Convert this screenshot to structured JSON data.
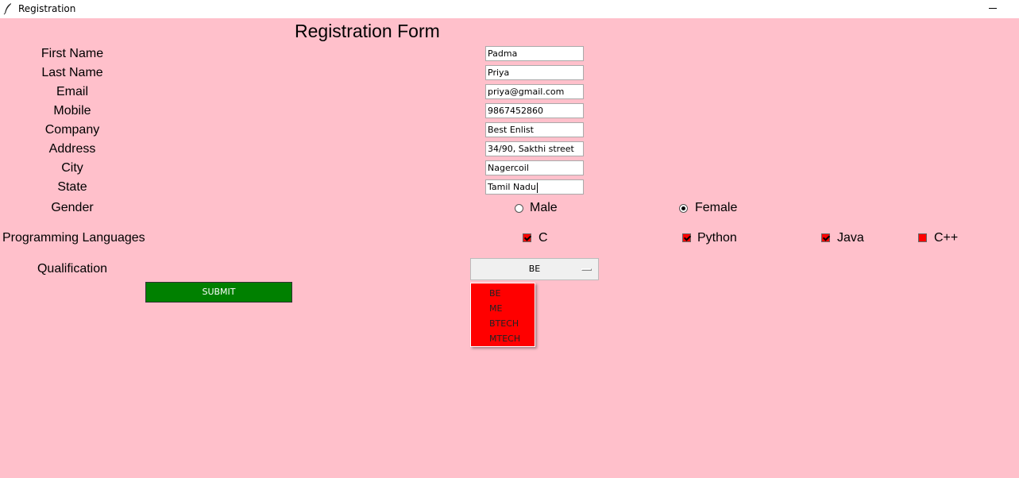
{
  "window": {
    "title": "Registration",
    "icon": "feather-icon"
  },
  "form": {
    "heading": "Registration Form",
    "fields": [
      {
        "label": "First Name",
        "value": "Padma"
      },
      {
        "label": "Last Name",
        "value": "Priya"
      },
      {
        "label": "Email",
        "value": "priya@gmail.com"
      },
      {
        "label": "Mobile",
        "value": "9867452860"
      },
      {
        "label": "Company",
        "value": "Best Enlist"
      },
      {
        "label": "Address",
        "value": "34/90, Sakthi street"
      },
      {
        "label": "City",
        "value": "Nagercoil"
      },
      {
        "label": "State",
        "value": "Tamil Nadu"
      }
    ],
    "gender": {
      "label": "Gender",
      "options": [
        {
          "label": "Male",
          "selected": false
        },
        {
          "label": "Female",
          "selected": true
        }
      ]
    },
    "languages": {
      "label": "Programming Languages",
      "options": [
        {
          "label": "C",
          "checked": true
        },
        {
          "label": "Python",
          "checked": true
        },
        {
          "label": "Java",
          "checked": true
        },
        {
          "label": "C++",
          "checked": false
        }
      ]
    },
    "qualification": {
      "label": "Qualification",
      "selected": "BE",
      "options": [
        "BE",
        "ME",
        "BTECH",
        "MTECH"
      ]
    },
    "submit_label": "SUBMIT"
  },
  "colors": {
    "background": "#ffc0cb",
    "submit": "#008000",
    "dropdown": "#ff0000",
    "checkbox": "#ff0000"
  }
}
